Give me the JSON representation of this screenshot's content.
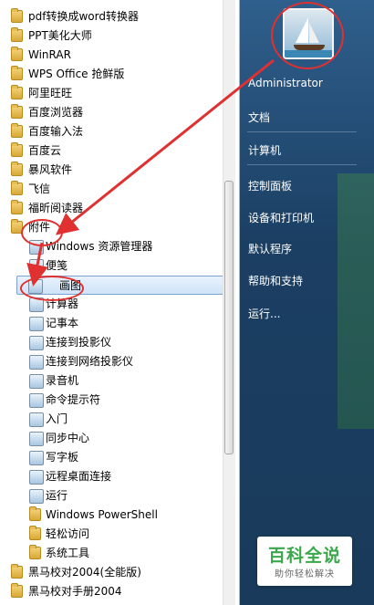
{
  "programs": [
    {
      "label": "pdf转换成word转换器",
      "icon": "folder-icon"
    },
    {
      "label": "PPT美化大师",
      "icon": "folder-icon"
    },
    {
      "label": "WinRAR",
      "icon": "folder-icon"
    },
    {
      "label": "WPS Office 抢鲜版",
      "icon": "folder-icon"
    },
    {
      "label": "阿里旺旺",
      "icon": "folder-icon"
    },
    {
      "label": "百度浏览器",
      "icon": "folder-icon"
    },
    {
      "label": "百度输入法",
      "icon": "folder-icon"
    },
    {
      "label": "百度云",
      "icon": "folder-icon"
    },
    {
      "label": "暴风软件",
      "icon": "folder-icon"
    },
    {
      "label": "飞信",
      "icon": "folder-icon"
    },
    {
      "label": "福昕阅读器",
      "icon": "folder-icon"
    },
    {
      "label": "附件",
      "icon": "folder-icon"
    },
    {
      "label": "Windows 资源管理器",
      "icon": "explorer-icon"
    },
    {
      "label": "便笺",
      "icon": "sticky-notes-icon"
    },
    {
      "label": "画图",
      "icon": "paint-icon"
    },
    {
      "label": "计算器",
      "icon": "calculator-icon"
    },
    {
      "label": "记事本",
      "icon": "notepad-icon"
    },
    {
      "label": "连接到投影仪",
      "icon": "projector-icon"
    },
    {
      "label": "连接到网络投影仪",
      "icon": "network-projector-icon"
    },
    {
      "label": "录音机",
      "icon": "microphone-icon"
    },
    {
      "label": "命令提示符",
      "icon": "cmd-icon"
    },
    {
      "label": "入门",
      "icon": "getting-started-icon"
    },
    {
      "label": "同步中心",
      "icon": "sync-icon"
    },
    {
      "label": "写字板",
      "icon": "wordpad-icon"
    },
    {
      "label": "远程桌面连接",
      "icon": "remote-desktop-icon"
    },
    {
      "label": "运行",
      "icon": "run-icon"
    },
    {
      "label": "Windows PowerShell",
      "icon": "folder-icon"
    },
    {
      "label": "轻松访问",
      "icon": "folder-icon"
    },
    {
      "label": "系统工具",
      "icon": "folder-icon"
    },
    {
      "label": "黑马校对2004(全能版)",
      "icon": "folder-icon"
    },
    {
      "label": "黑马校对手册2004",
      "icon": "folder-icon"
    }
  ],
  "right_panel": {
    "user": "Administrator",
    "items": [
      "文档",
      "计算机",
      "控制面板",
      "设备和打印机",
      "默认程序",
      "帮助和支持",
      "运行..."
    ]
  },
  "watermark": {
    "title": "百科全说",
    "subtitle": "助你轻松解决"
  },
  "colors": {
    "annotation": "#e03030",
    "selection": "#cfe3f9",
    "panel": "#1b3f63"
  }
}
